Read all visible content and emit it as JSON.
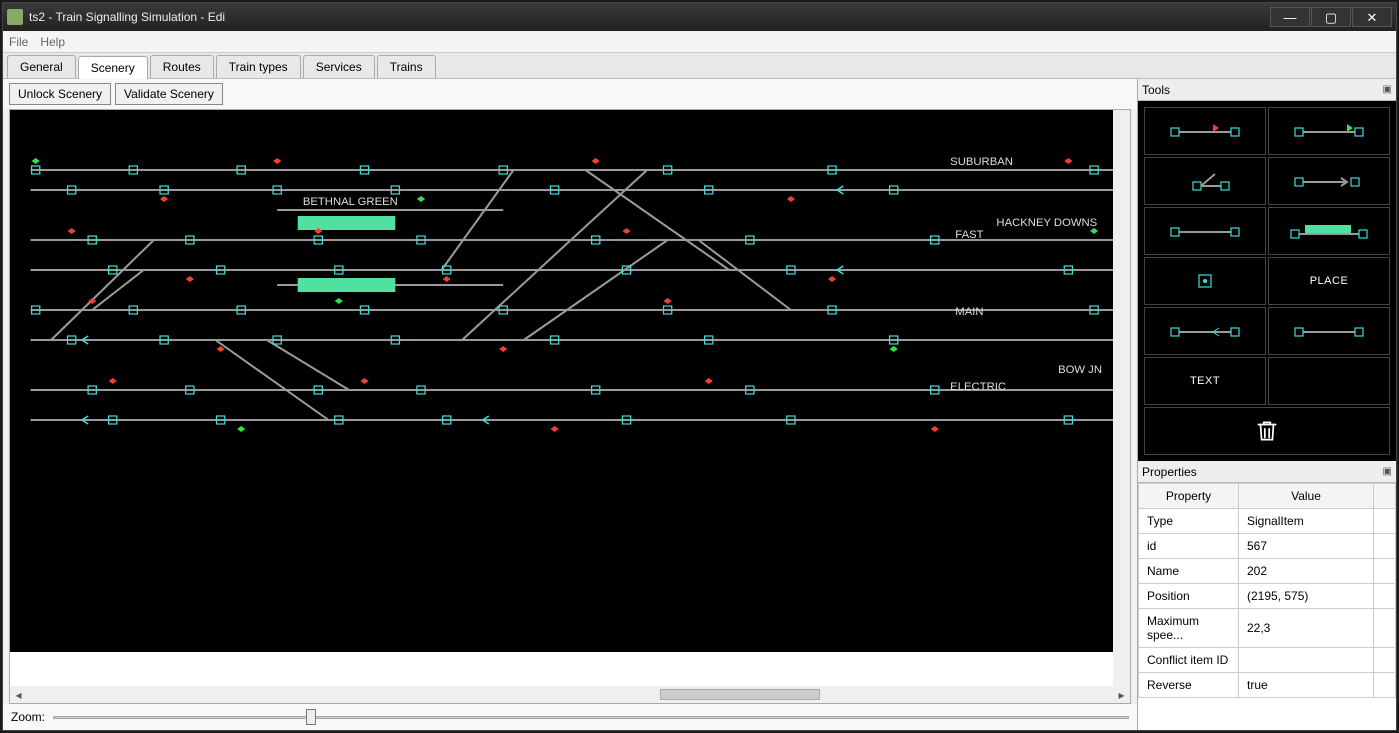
{
  "window": {
    "title": "ts2 - Train Signalling Simulation - Edi"
  },
  "menu": {
    "file": "File",
    "help": "Help"
  },
  "tabs": [
    "General",
    "Scenery",
    "Routes",
    "Train types",
    "Services",
    "Trains"
  ],
  "active_tab": "Scenery",
  "scenery_toolbar": {
    "unlock": "Unlock Scenery",
    "validate": "Validate Scenery"
  },
  "zoom": {
    "label": "Zoom:"
  },
  "right": {
    "tools_title": "Tools",
    "properties_title": "Properties"
  },
  "tool_labels": {
    "place": "PLACE",
    "text": "TEXT"
  },
  "properties": {
    "headers": [
      "Property",
      "Value"
    ],
    "rows": [
      {
        "k": "Type",
        "v": "SignalItem"
      },
      {
        "k": "id",
        "v": "567"
      },
      {
        "k": "Name",
        "v": "202"
      },
      {
        "k": "Position",
        "v": "(2195, 575)"
      },
      {
        "k": "Maximum spee...",
        "v": "22,3"
      },
      {
        "k": "Conflict item ID",
        "v": ""
      },
      {
        "k": "Reverse",
        "v": "true"
      }
    ]
  },
  "scene_labels": {
    "bethnal_green": "BETHNAL GREEN",
    "suburban": "SUBURBAN",
    "hackney_downs": "HACKNEY DOWNS",
    "fast": "FAST",
    "main": "MAIN",
    "bow_jn": "BOW JN",
    "electric": "ELECTRIC"
  }
}
